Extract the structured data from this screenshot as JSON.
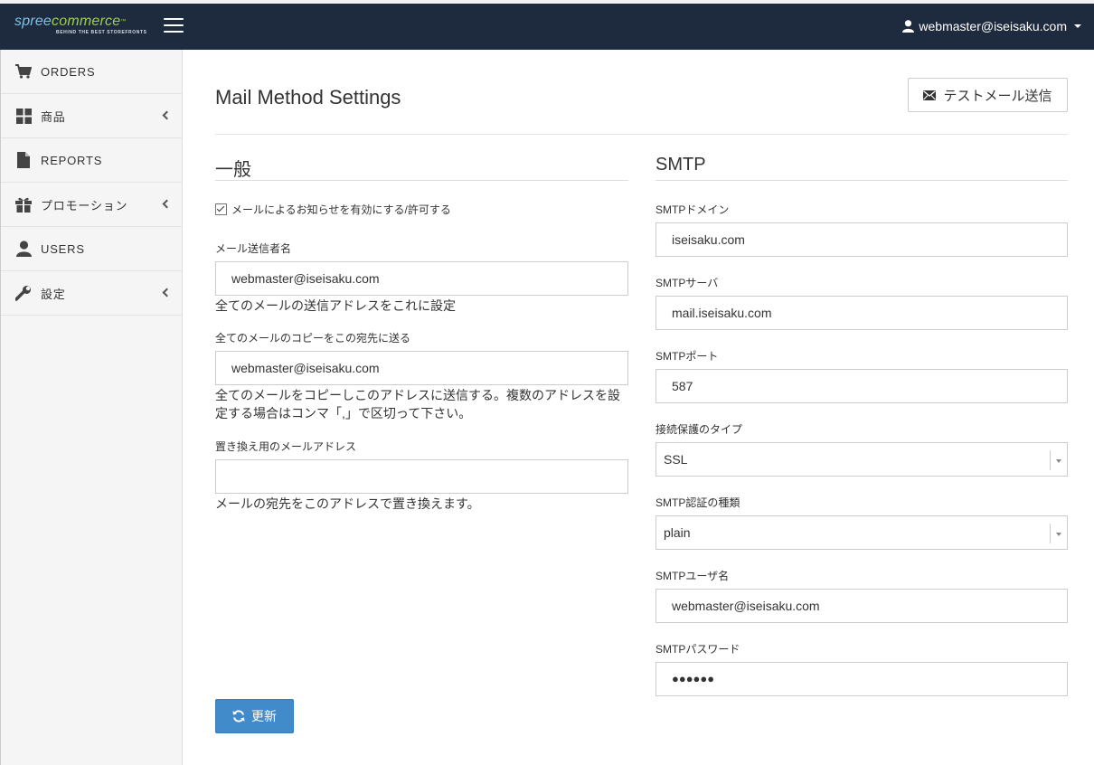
{
  "header": {
    "logo_brand_a": "spree",
    "logo_brand_b": "commerce",
    "logo_tm": "™",
    "logo_tagline": "BEHIND THE BEST STOREFRONTS",
    "user_email": "webmaster@iseisaku.com"
  },
  "sidebar": {
    "items": [
      {
        "label": "ORDERS",
        "icon": "cart-icon"
      },
      {
        "label": "商品",
        "icon": "grid-icon"
      },
      {
        "label": "REPORTS",
        "icon": "file-icon"
      },
      {
        "label": "プロモーション",
        "icon": "gift-icon"
      },
      {
        "label": "USERS",
        "icon": "user-icon"
      },
      {
        "label": "設定",
        "icon": "wrench-icon"
      }
    ]
  },
  "page": {
    "title": "Mail Method Settings",
    "test_button": "テストメール送信",
    "update_button": "更新"
  },
  "general": {
    "heading": "一般",
    "enable_label": "メールによるお知らせを有効にする/許可する",
    "sender_label": "メール送信者名",
    "sender_value": "webmaster@iseisaku.com",
    "sender_help": "全てのメールの送信アドレスをこれに設定",
    "copy_label": "全てのメールのコピーをこの宛先に送る",
    "copy_value": "webmaster@iseisaku.com",
    "copy_help": "全てのメールをコピーしこのアドレスに送信する。複数のアドレスを設定する場合はコンマ「,」で区切って下さい。",
    "intercept_label": "置き換え用のメールアドレス",
    "intercept_value": "",
    "intercept_help": "メールの宛先をこのアドレスで置き換えます。"
  },
  "smtp": {
    "heading": "SMTP",
    "domain_label": "SMTPドメイン",
    "domain_value": "iseisaku.com",
    "server_label": "SMTPサーバ",
    "server_value": "mail.iseisaku.com",
    "port_label": "SMTPポート",
    "port_value": "587",
    "security_label": "接続保護のタイプ",
    "security_value": "SSL",
    "auth_label": "SMTP認証の種類",
    "auth_value": "plain",
    "user_label": "SMTPユーザ名",
    "user_value": "webmaster@iseisaku.com",
    "password_label": "SMTPパスワード",
    "password_value": "●●●●●●"
  }
}
